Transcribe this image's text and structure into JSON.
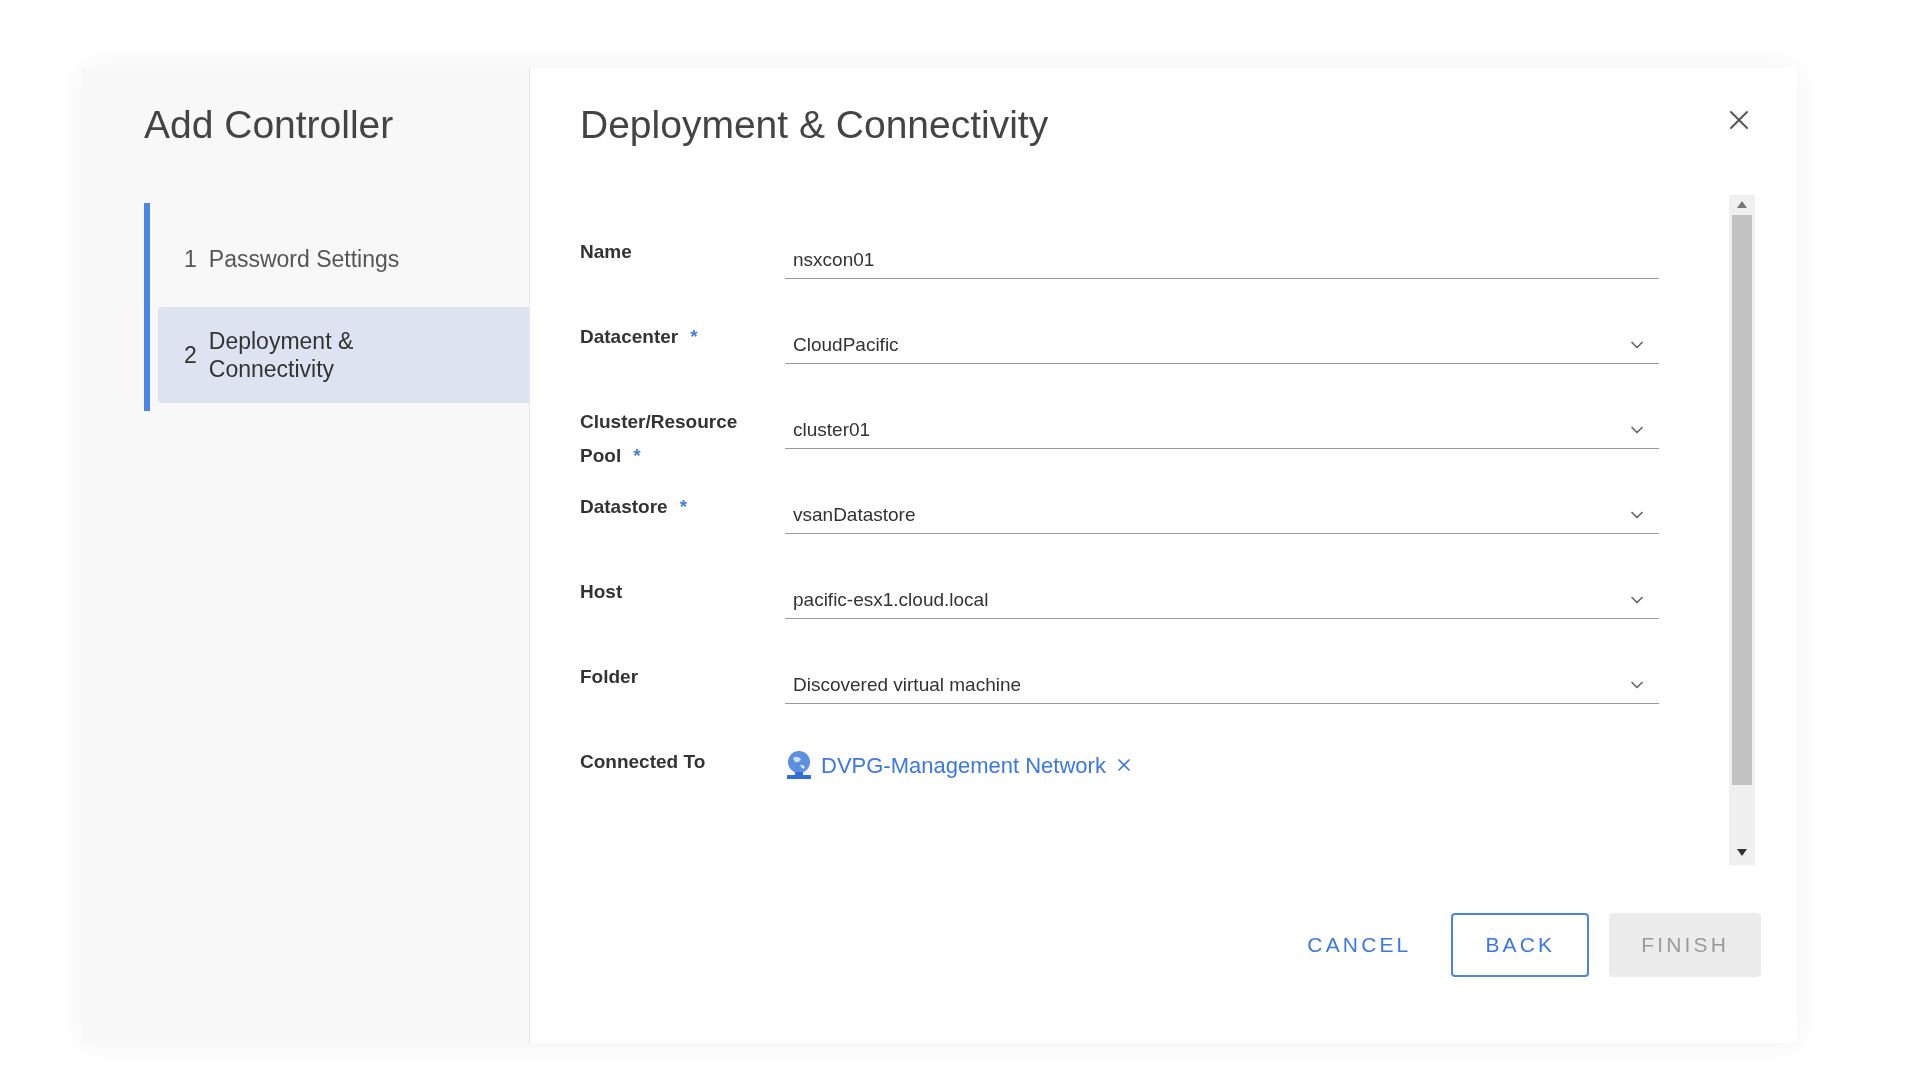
{
  "wizard": {
    "title": "Add Controller",
    "steps": [
      {
        "number": "1",
        "label": "Password Settings",
        "selected": false
      },
      {
        "number": "2",
        "label": "Deployment & Connectivity",
        "selected": true
      }
    ]
  },
  "page": {
    "title": "Deployment & Connectivity",
    "fields": [
      {
        "kind": "text",
        "label": "Name",
        "value": "nsxcon01"
      },
      {
        "kind": "select",
        "label": "Datacenter",
        "required_mark": "*",
        "value": "CloudPacific"
      },
      {
        "kind": "select",
        "label": "Cluster/Resource Pool",
        "required_mark": "*",
        "value": "cluster01"
      },
      {
        "kind": "select",
        "label": "Datastore",
        "required_mark": "*",
        "value": "vsanDatastore"
      },
      {
        "kind": "select",
        "label": "Host",
        "value": "pacific-esx1.cloud.local"
      },
      {
        "kind": "select",
        "label": "Folder",
        "value": "Discovered virtual machine"
      },
      {
        "kind": "network",
        "label": "Connected To",
        "value": "DVPG-Management Network"
      }
    ]
  },
  "buttons": [
    {
      "kind": "link",
      "label": "CANCEL",
      "disabled": false
    },
    {
      "kind": "outline",
      "label": "BACK",
      "disabled": false
    },
    {
      "kind": "solid",
      "label": "FINISH",
      "disabled": true
    }
  ]
}
